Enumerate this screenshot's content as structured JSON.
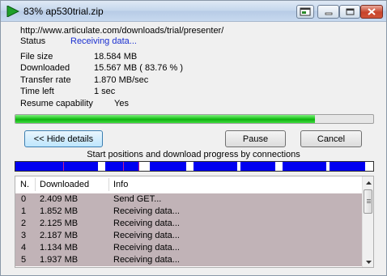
{
  "window": {
    "title": "83% ap530trial.zip",
    "controls": [
      "restore-icon",
      "minimize-icon",
      "maximize-icon",
      "close-icon"
    ],
    "accent_close": "#c7442b"
  },
  "download": {
    "url": "http://www.articulate.com/downloads/trial/presenter/",
    "status_label": "Status",
    "status_value": "Receiving data...",
    "fields": [
      {
        "label": "File size",
        "value": "18.584  MB"
      },
      {
        "label": "Downloaded",
        "value": "15.567  MB  ( 83.76 % )"
      },
      {
        "label": "Transfer rate",
        "value": "1.870  MB/sec"
      },
      {
        "label": "Time left",
        "value": "1 sec"
      },
      {
        "label": "Resume capability",
        "value": "Yes"
      }
    ],
    "progress_fraction": 0.8376,
    "progress_color": "#22c722"
  },
  "buttons": {
    "hide_details": "<< Hide details",
    "pause": "Pause",
    "cancel": "Cancel"
  },
  "connections": {
    "caption": "Start positions and download progress by connections",
    "bar_color": "#0000f0"
  },
  "table": {
    "headers": [
      "N.",
      "Downloaded",
      "Info"
    ],
    "rows": [
      {
        "n": "0",
        "downloaded": "2.409  MB",
        "info": "Send GET..."
      },
      {
        "n": "1",
        "downloaded": "1.852  MB",
        "info": "Receiving data..."
      },
      {
        "n": "2",
        "downloaded": "2.125  MB",
        "info": "Receiving data..."
      },
      {
        "n": "3",
        "downloaded": "2.187  MB",
        "info": "Receiving data..."
      },
      {
        "n": "4",
        "downloaded": "1.134  MB",
        "info": "Receiving data..."
      },
      {
        "n": "5",
        "downloaded": "1.937  MB",
        "info": "Receiving data..."
      }
    ],
    "row_color": "#c1b3b7"
  }
}
